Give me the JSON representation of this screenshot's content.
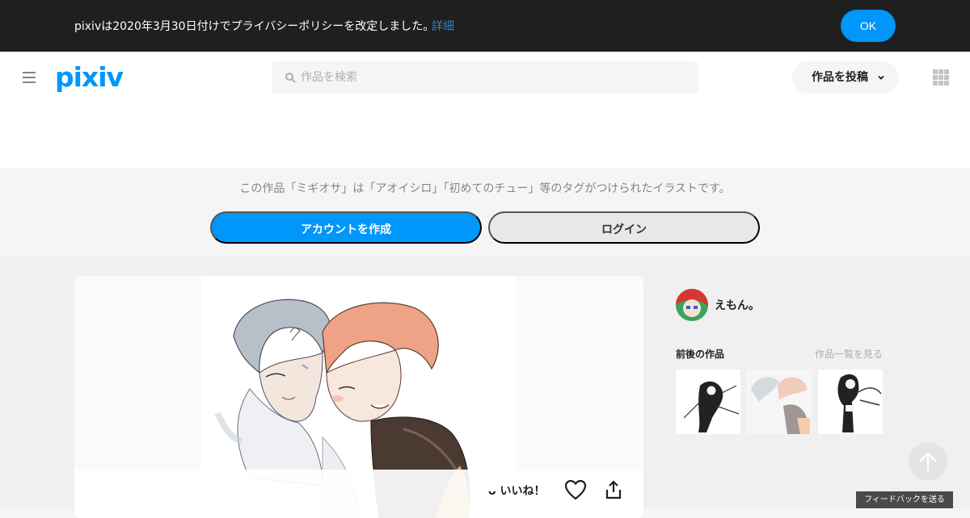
{
  "notice": {
    "text": "pixivは2020年3月30日付けでプライバシーポリシーを改定しました。",
    "link": "詳細",
    "ok_label": "OK"
  },
  "header": {
    "logo": "pixiv",
    "search_placeholder": "作品を検索",
    "post_label": "作品を投稿"
  },
  "promo": {
    "text": "この作品「ミギオサ」は「アオイシロ」「初めてのチュー」等のタグがつけられたイラストです。",
    "create_label": "アカウントを作成",
    "login_label": "ログイン"
  },
  "artwork": {
    "like_label": "いいね！"
  },
  "sidebar": {
    "author_name": "えもん。",
    "adjacent_title": "前後の作品",
    "adjacent_link": "作品一覧を見る"
  },
  "feedback_label": "フィードバックを送る",
  "colors": {
    "brand": "#0096fa",
    "notice_bg": "#1f1f1f",
    "link": "#3d7fc6"
  }
}
